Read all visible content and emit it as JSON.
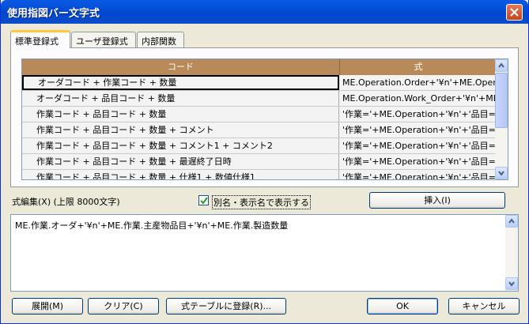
{
  "window": {
    "title": "使用指図バー文字式"
  },
  "tabs": [
    {
      "label": "標準登録式"
    },
    {
      "label": "ユーザ登録式"
    },
    {
      "label": "内部関数"
    }
  ],
  "grid": {
    "columns": [
      "コード",
      "式"
    ],
    "rows": [
      {
        "code": "オーダコード + 作業コード + 数量",
        "formula": "ME.Operation.Order+'¥n'+ME.Operation."
      },
      {
        "code": "オーダコード + 品目コード + 数量",
        "formula": "ME.Operation.Work_Order+'¥n'+ME.Ope"
      },
      {
        "code": "作業コード + 品目コード + 数量",
        "formula": "'作業='+ME.Operation+'¥n'+'品目='+ME."
      },
      {
        "code": "作業コード + 品目コード + 数量 + コメント",
        "formula": "'作業='+ME.Operation+'¥n'+'品目='+ME."
      },
      {
        "code": "作業コード + 品目コード + 数量 + コメント1 + コメント2",
        "formula": "'作業='+ME.Operation+'¥n'+'品目='+ME."
      },
      {
        "code": "作業コード + 品目コード + 数量 + 最遅終了日時",
        "formula": "'作業='+ME.Operation+'¥n'+'品目='+ME."
      },
      {
        "code": "作業コード + 品目コード + 数量 + 仕様1 + 数値仕様1",
        "formula": "'作業='+ME.Operation+'¥n'+'品目='+ME."
      }
    ]
  },
  "edit": {
    "label": "式編集(X) (上限 8000文字)",
    "checkbox_label": "別名・表示名で表示する",
    "checkbox_checked": true,
    "insert_button": "挿入(I)",
    "text": "ME.作業.オーダ+'¥n'+ME.作業.主産物品目+'¥n'+ME.作業.製造数量"
  },
  "buttons": {
    "expand": "展開(M)",
    "clear": "クリア(C)",
    "register": "式テーブルに登録(R)...",
    "ok": "OK",
    "cancel": "キャンセル"
  },
  "icons": {
    "close": "close-icon",
    "check": "check-icon",
    "scroll_up": "arrow-up-icon",
    "scroll_down": "arrow-down-icon"
  }
}
